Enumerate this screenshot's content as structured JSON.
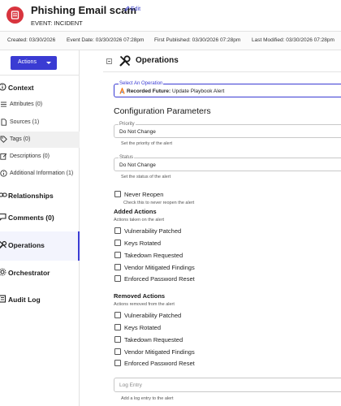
{
  "header": {
    "title": "Phishing Email scam",
    "edit_label": "Edit",
    "subtitle": "EVENT: INCIDENT",
    "icon": "incident-icon",
    "accent_color": "#d8343e"
  },
  "meta": {
    "created": "Created: 03/30/2026",
    "event_date": "Event Date: 03/30/2026 07:28pm",
    "first_published": "First Published: 03/30/2026 07:28pm",
    "last_modified": "Last Modified: 03/30/2026 07:28pm"
  },
  "sidebar": {
    "actions_label": "Actions",
    "actions_color": "#3a3bd3",
    "context_label": "Context",
    "context_items": [
      {
        "label": "Attributes (0)",
        "icon": "list-icon"
      },
      {
        "label": "Sources (1)",
        "icon": "document-icon"
      },
      {
        "label": "Tags (0)",
        "icon": "tag-icon"
      },
      {
        "label": "Descriptions (0)",
        "icon": "edit-icon"
      },
      {
        "label": "Additional Information (1)",
        "icon": "info-icon"
      }
    ],
    "relationships_label": "Relationships",
    "comments_label": "Comments (0)",
    "operations_label": "Operations",
    "orchestrator_label": "Orchestrator",
    "audit_log_label": "Audit Log"
  },
  "main": {
    "title": "Operations",
    "select_operation": {
      "label": "Select An Operation",
      "value_bold": "Recorded Future:",
      "value_rest": " Update Playbook Alert"
    },
    "config_title": "Configuration Parameters",
    "priority": {
      "label": "Priority",
      "value": "Do Not Change",
      "hint": "Set the priority of the alert"
    },
    "status": {
      "label": "Status",
      "value": "Do Not Change",
      "hint": "Set the status of the alert"
    },
    "never_reopen": {
      "label": "Never Reopen",
      "hint": "Check this to never reopen the alert"
    },
    "added_actions": {
      "title": "Added Actions",
      "hint": "Actions taken on the alert",
      "items": [
        "Vulnerability Patched",
        "Keys Rotated",
        "Takedown Requested",
        "Vendor Mitigated Findings",
        "Enforced Password Reset"
      ]
    },
    "removed_actions": {
      "title": "Removed Actions",
      "hint": "Actions removed from the alert",
      "items": [
        "Vulnerability Patched",
        "Keys Rotated",
        "Takedown Requested",
        "Vendor Mitigated Findings",
        "Enforced Password Reset"
      ]
    },
    "log_entry": {
      "placeholder": "Log Entry",
      "hint": "Add a log entry to the alert"
    }
  }
}
